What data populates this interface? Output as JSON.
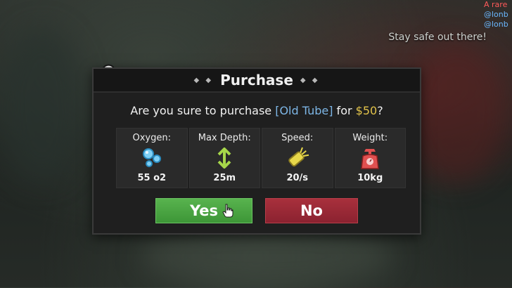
{
  "chat": {
    "line1": "A rare",
    "line2": "@lonb",
    "line3": "@lonb"
  },
  "notice": "Stay safe out there!",
  "dialog": {
    "title": "Purchase",
    "title_deco_left": "◆ ◆",
    "title_deco_right": "◆ ◆",
    "question_prefix": "Are you sure to purchase ",
    "item_name": "[Old Tube]",
    "question_mid": " for ",
    "price": "$50",
    "question_suffix": "?",
    "stats": [
      {
        "label": "Oxygen:",
        "value": "55 o2",
        "icon": "bubbles-icon"
      },
      {
        "label": "Max Depth:",
        "value": "25m",
        "icon": "depth-arrow-icon"
      },
      {
        "label": "Speed:",
        "value": "20/s",
        "icon": "speed-tube-icon"
      },
      {
        "label": "Weight:",
        "value": "10kg",
        "icon": "scale-icon"
      }
    ],
    "yes_label": "Yes",
    "no_label": "No"
  },
  "colors": {
    "item": "#7db6e6",
    "price": "#e2c34a",
    "yes": "#4caa43",
    "no": "#9a2836"
  }
}
